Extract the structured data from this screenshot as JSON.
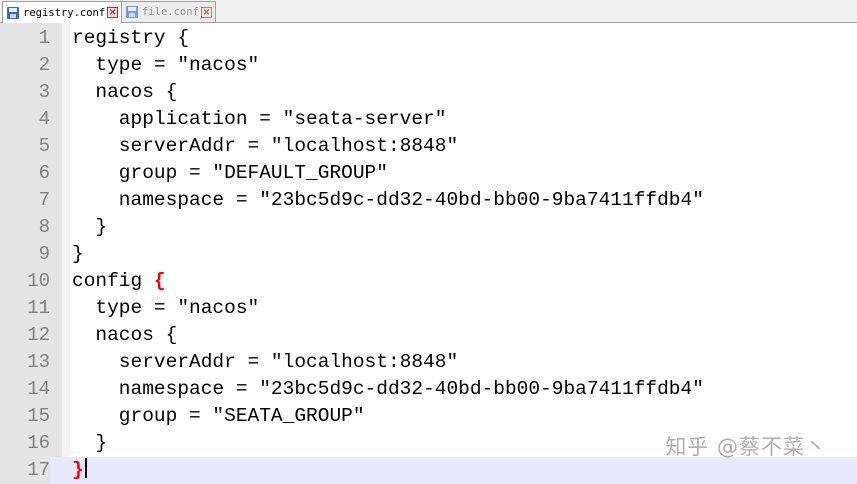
{
  "tabs": [
    {
      "label": "registry.conf",
      "active": true
    },
    {
      "label": "file.conf",
      "active": false
    }
  ],
  "lines": [
    {
      "num": "1",
      "text": "registry {"
    },
    {
      "num": "2",
      "text": "  type = \"nacos\""
    },
    {
      "num": "3",
      "text": "  nacos {"
    },
    {
      "num": "4",
      "text": "    application = \"seata-server\""
    },
    {
      "num": "5",
      "text": "    serverAddr = \"localhost:8848\""
    },
    {
      "num": "6",
      "text": "    group = \"DEFAULT_GROUP\""
    },
    {
      "num": "7",
      "text": "    namespace = \"23bc5d9c-dd32-40bd-bb00-9ba7411ffdb4\""
    },
    {
      "num": "8",
      "text": "  }"
    },
    {
      "num": "9",
      "text": "}"
    },
    {
      "num": "10",
      "text": "config ",
      "brace": "{"
    },
    {
      "num": "11",
      "text": "  type = \"nacos\""
    },
    {
      "num": "12",
      "text": "  nacos {"
    },
    {
      "num": "13",
      "text": "    serverAddr = \"localhost:8848\""
    },
    {
      "num": "14",
      "text": "    namespace = \"23bc5d9c-dd32-40bd-bb00-9ba7411ffdb4\""
    },
    {
      "num": "15",
      "text": "    group = \"SEATA_GROUP\""
    },
    {
      "num": "16",
      "text": "  }"
    },
    {
      "num": "17",
      "text": "",
      "brace": "}",
      "current": true
    }
  ],
  "watermark": "知乎 @蔡不菜丶",
  "colors": {
    "brace_highlight": "#ff0000",
    "current_line": "#e8e8ff",
    "gutter": "#e4e4e4"
  }
}
